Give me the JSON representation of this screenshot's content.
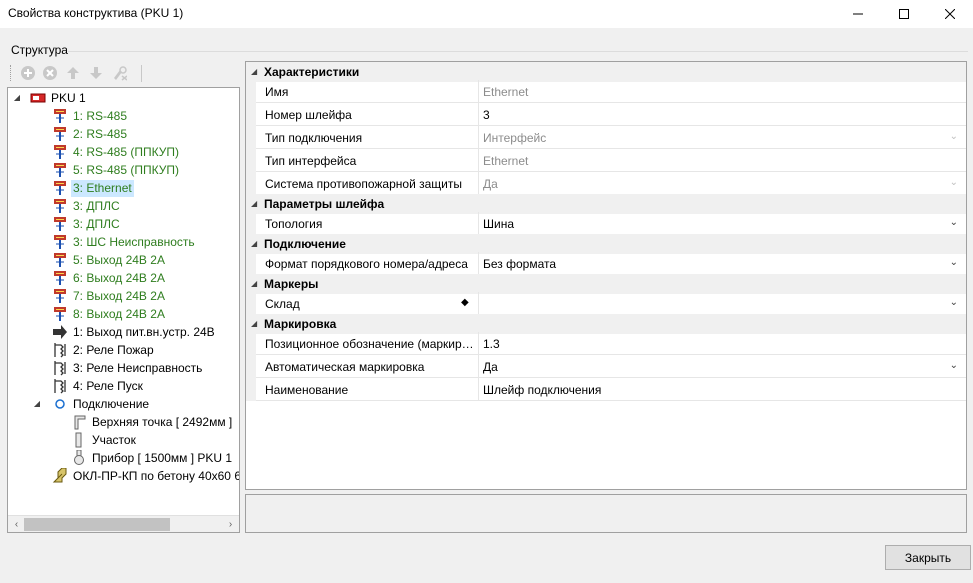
{
  "window": {
    "title": "Свойства конструктива (PKU 1)"
  },
  "structure": {
    "label": "Структура"
  },
  "tree": {
    "items": [
      {
        "label": "PKU 1"
      },
      {
        "label": "1: RS-485"
      },
      {
        "label": "2: RS-485"
      },
      {
        "label": "4: RS-485 (ППКУП)"
      },
      {
        "label": "5: RS-485 (ППКУП)"
      },
      {
        "label": "3: Ethernet"
      },
      {
        "label": "3: ДПЛС"
      },
      {
        "label": "3: ДПЛС"
      },
      {
        "label": "3: ШС Неисправность"
      },
      {
        "label": "5: Выход 24В 2А"
      },
      {
        "label": "6: Выход 24В 2А"
      },
      {
        "label": "7: Выход 24В 2А"
      },
      {
        "label": "8: Выход 24В 2А"
      },
      {
        "label": "1: Выход пит.вн.устр. 24В"
      },
      {
        "label": "2: Реле Пожар"
      },
      {
        "label": "3: Реле Неисправность"
      },
      {
        "label": "4: Реле Пуск"
      },
      {
        "label": "Подключение"
      },
      {
        "label": "Верхняя точка [ 2492мм ]"
      },
      {
        "label": "Участок"
      },
      {
        "label": "Прибор [ 1500мм ] PKU 1"
      },
      {
        "label": "ОКЛ-ПР-КП по бетону 40x60 6"
      }
    ]
  },
  "properties": {
    "categories": [
      {
        "label": "Характеристики"
      },
      {
        "label": "Параметры шлейфа"
      },
      {
        "label": "Подключение"
      },
      {
        "label": "Маркеры"
      },
      {
        "label": "Маркировка"
      }
    ],
    "rows": [
      {
        "name": "Имя",
        "value": "Ethernet"
      },
      {
        "name": "Номер шлейфа",
        "value": "3"
      },
      {
        "name": "Тип подключения",
        "value": "Интерфейс"
      },
      {
        "name": "Тип интерфейса",
        "value": "Ethernet"
      },
      {
        "name": "Система противопожарной защиты",
        "value": "Да"
      },
      {
        "name": "Топология",
        "value": "Шина"
      },
      {
        "name": "Формат порядкового номера/адреса",
        "value": "Без формата"
      },
      {
        "name": "Склад",
        "value": ""
      },
      {
        "name": "Позиционное обозначение (маркировка)",
        "value": "1.3"
      },
      {
        "name": "Автоматическая маркировка",
        "value": "Да"
      },
      {
        "name": "Наименование",
        "value": "Шлейф подключения"
      }
    ]
  },
  "buttons": {
    "close": "Закрыть"
  },
  "colors": {
    "green_text": "#2e7d1e",
    "selection": "#cce8ff",
    "disabled_text": "#8c8c8c"
  }
}
